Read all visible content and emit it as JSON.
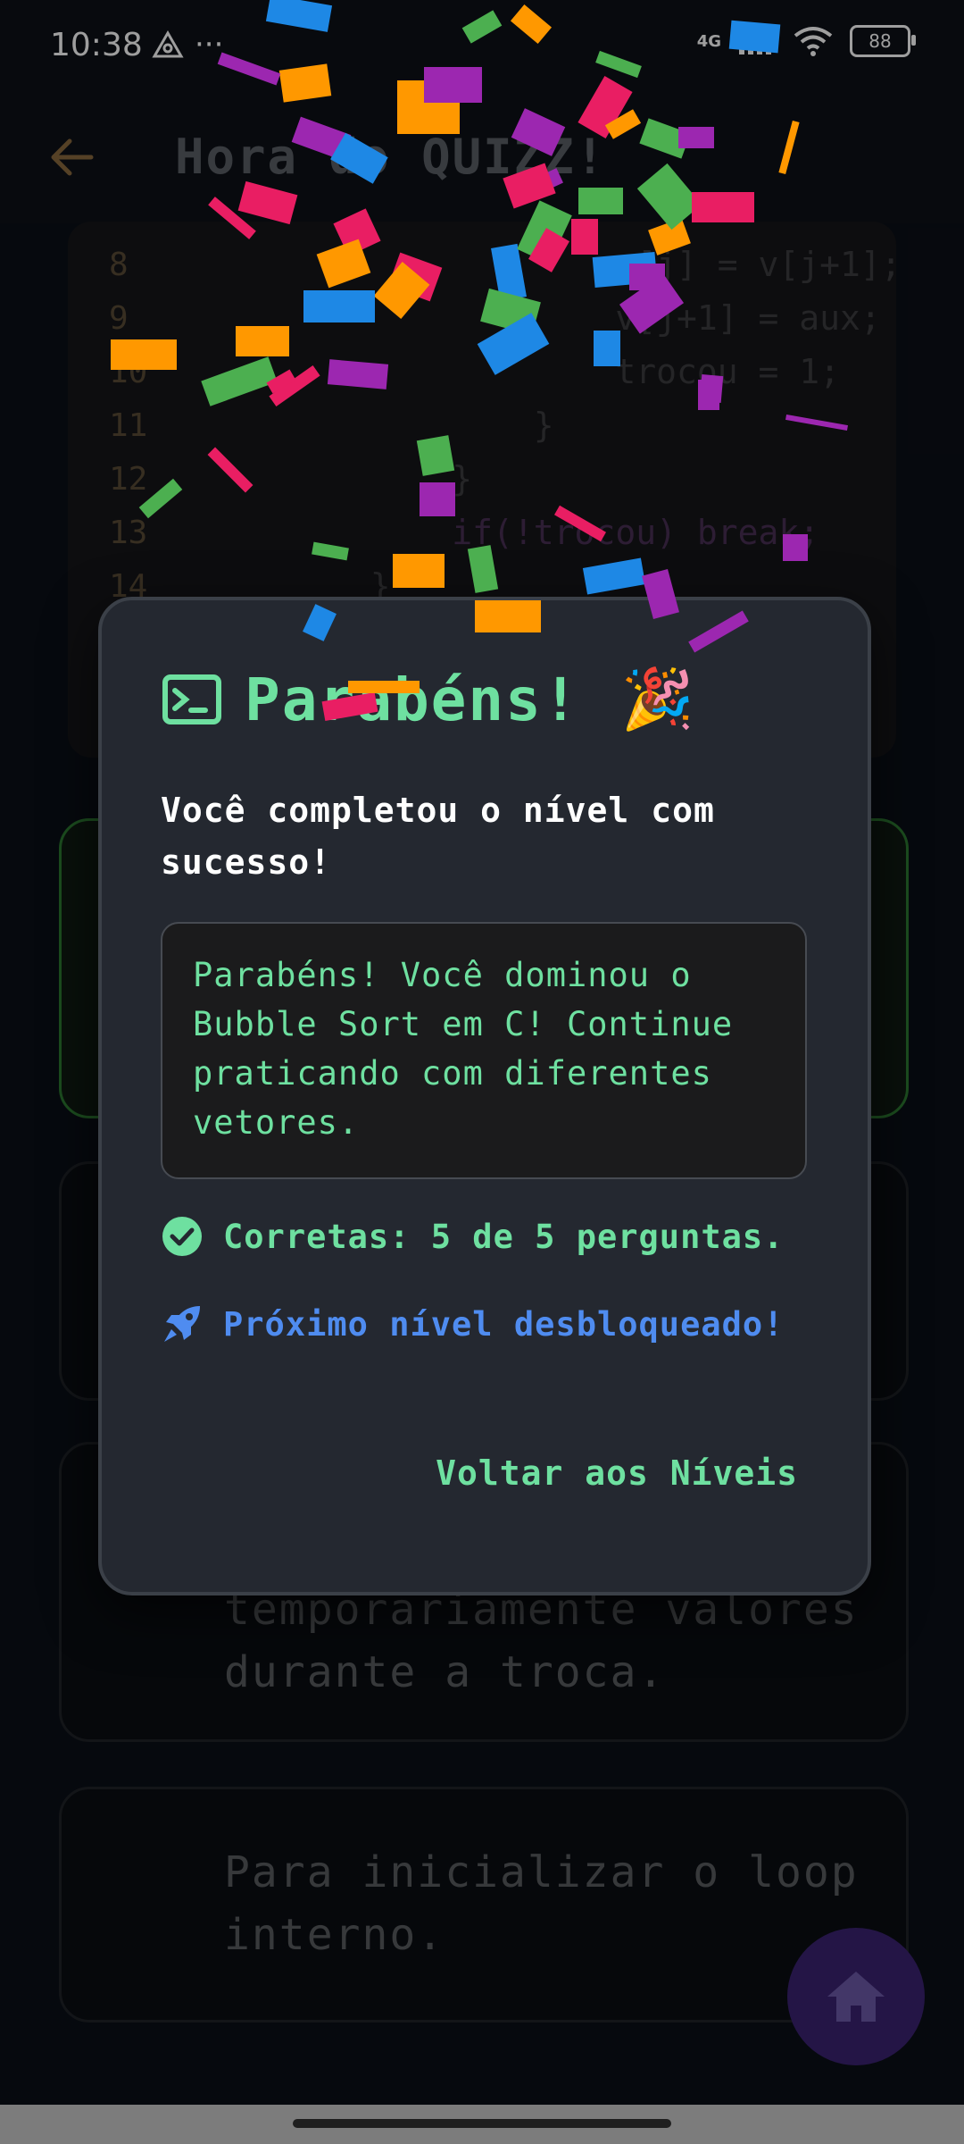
{
  "status_bar": {
    "time": "10:38",
    "network": "4G",
    "battery": "88"
  },
  "app_bar": {
    "title": "Hora do QUIZZ!"
  },
  "code": {
    "lines": [
      {
        "num": "8",
        "text": "                      v[j] = v[j+1];"
      },
      {
        "num": "9",
        "text": "                      v[j+1] = aux;"
      },
      {
        "num": "10",
        "text": "                      trocou = 1;"
      },
      {
        "num": "11",
        "text": "                  }"
      },
      {
        "num": "12",
        "text": "              }"
      },
      {
        "num": "13",
        "text": "              if(!trocou) break;"
      },
      {
        "num": "14",
        "text": "          }"
      }
    ]
  },
  "answers": [
    {
      "text": ""
    },
    {
      "text": ""
    },
    {
      "text": "temporariamente valores\ndurante a troca."
    },
    {
      "text": "Para inicializar o loop\ninterno."
    }
  ],
  "dialog": {
    "title": "Parabéns!",
    "emoji": "🎉",
    "subtitle": "Você completou o nível com sucesso!",
    "message": "Parabéns! Você dominou o Bubble Sort em C! Continue praticando com diferentes vetores.",
    "correct_text": "Corretas: 5 de 5 perguntas.",
    "next_text": "Próximo nível desbloqueado!",
    "back_button": "Voltar aos Níveis"
  },
  "colors": {
    "accent_green": "#6ee0a0",
    "accent_blue": "#4f8cf0",
    "fab": "#3a2372"
  }
}
